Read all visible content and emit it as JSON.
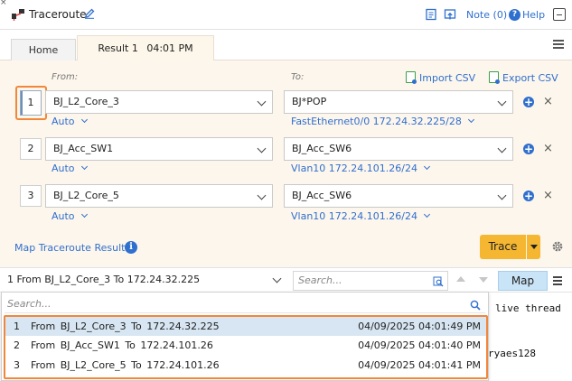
{
  "window": {
    "title": "Traceroute",
    "note_label": "Note (0)",
    "help_label": "Help",
    "close_glyph": "×"
  },
  "tabs": [
    {
      "label": "Home"
    },
    {
      "label": "Result 1",
      "time": "04:01 PM"
    }
  ],
  "form": {
    "from_label": "From:",
    "to_label": "To:",
    "import_csv": "Import CSV",
    "export_csv": "Export CSV",
    "rows": [
      {
        "index": "1",
        "from": "BJ_L2_Core_3",
        "from_sub": "Auto",
        "to": "BJ*POP",
        "to_sub": "FastEthernet0/0 172.24.32.225/28"
      },
      {
        "index": "2",
        "from": "BJ_Acc_SW1",
        "from_sub": "Auto",
        "to": "BJ_Acc_SW6",
        "to_sub": "Vlan10 172.24.101.26/24"
      },
      {
        "index": "3",
        "from": "BJ_L2_Core_5",
        "from_sub": "Auto",
        "to": "BJ_Acc_SW6",
        "to_sub": "Vlan10 172.24.101.26/24"
      }
    ],
    "map_result_label": "Map Traceroute Result",
    "trace_button": "Trace"
  },
  "results_bar": {
    "selected": "1 From BJ_L2_Core_3 To 172.24.32.225",
    "search_placeholder": "Search...",
    "map_button": "Map"
  },
  "log_fragments": [
    "live thread",
    "ryaes128"
  ],
  "dropdown": {
    "search_placeholder": "Search...",
    "items": [
      {
        "num": "1",
        "desc": "From  BJ_L2_Core_3  To  172.24.32.225",
        "time": "04/09/2025 04:01:49 PM",
        "selected": true
      },
      {
        "num": "2",
        "desc": "From  BJ_Acc_SW1  To  172.24.101.26",
        "time": "04/09/2025 04:01:40 PM",
        "selected": false
      },
      {
        "num": "3",
        "desc": "From  BJ_L2_Core_5  To  172.24.101.26",
        "time": "04/09/2025 04:01:41 PM",
        "selected": false
      }
    ]
  },
  "colors": {
    "accent": "#2f6fce",
    "highlight": "#f0873a",
    "trace_button": "#f5b731",
    "panel_bg": "#fdf6ec",
    "selected_row": "#d7e6f2"
  },
  "icons": [
    "traceroute-icon",
    "edit-icon",
    "note-icon",
    "export-window-icon",
    "help-icon",
    "minimize-icon",
    "menu-icon",
    "csv-icon",
    "add-icon",
    "delete-icon",
    "info-icon",
    "gear-icon",
    "search-icon",
    "chevron-down-icon"
  ]
}
